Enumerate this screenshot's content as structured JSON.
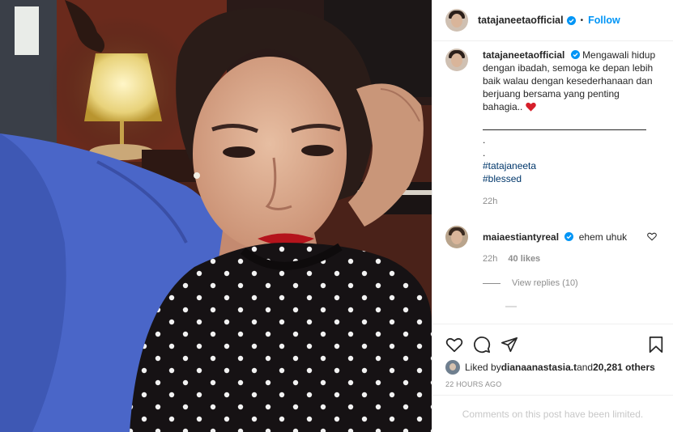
{
  "post": {
    "username": "tatajaneetaofficial",
    "follow_label": "Follow",
    "separator": "•"
  },
  "caption": {
    "username": "tatajaneetaofficial",
    "text": "Mengawali hidup dengan ibadah, semoga ke depan lebih baik walau dengan kesederhanaan dan berjuang bersama yang penting bahagia.. ",
    "dots": [
      ".",
      "."
    ],
    "hashtags": [
      "#tatajaneeta",
      "#blessed"
    ],
    "time": "22h"
  },
  "comment": {
    "username": "maiaestiantyreal",
    "text": "ehem uhuk",
    "time": "22h",
    "likes": "40 likes",
    "view_replies": "View replies (10)"
  },
  "likes": {
    "prefix": "Liked by ",
    "user": "dianaanastasia.t",
    "middle": " and ",
    "count": "20,281 others"
  },
  "posted_ago": "22 HOURS AGO",
  "comments_limited": "Comments on this post have been limited.",
  "icons": [
    "heart-icon",
    "comment-icon",
    "share-icon",
    "bookmark-icon",
    "verified-icon"
  ],
  "colors": {
    "link": "#0095f6",
    "hashtag": "#00376b",
    "verified": "#0095f6",
    "heart": "#ed4956"
  }
}
